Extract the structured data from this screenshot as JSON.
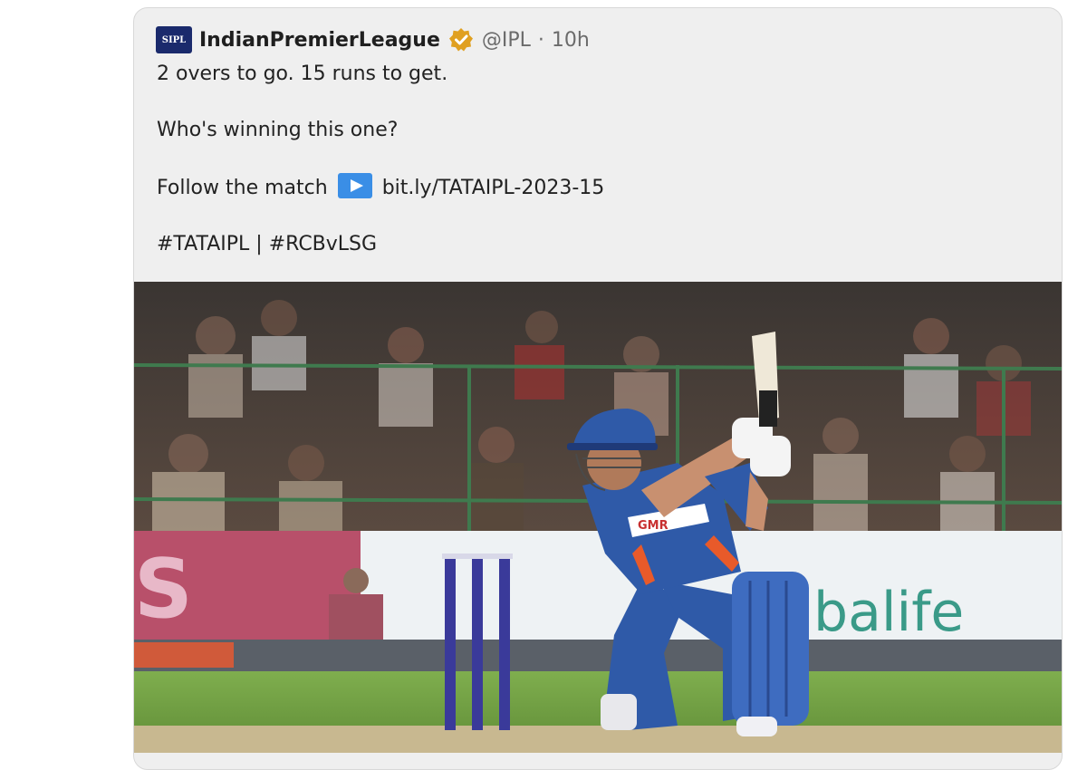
{
  "tweet": {
    "avatar_text": "SIPL",
    "display_name": "IndianPremierLeague",
    "handle": "@IPL",
    "separator": "·",
    "time": "10h",
    "lines": [
      "2 overs to go. 15 runs to get.",
      "Who's winning this one?"
    ],
    "follow_prefix": "Follow the match",
    "link": "bit.ly/TATAIPL-2023-15",
    "hashtags": "#TATAIPL | #RCBvLSG"
  },
  "image": {
    "sponsor_text": "balife",
    "shirt_text": "GMR"
  },
  "colors": {
    "verified": "#e0a020",
    "accent": "#3a8ee6",
    "jersey": "#2f5aa8"
  }
}
